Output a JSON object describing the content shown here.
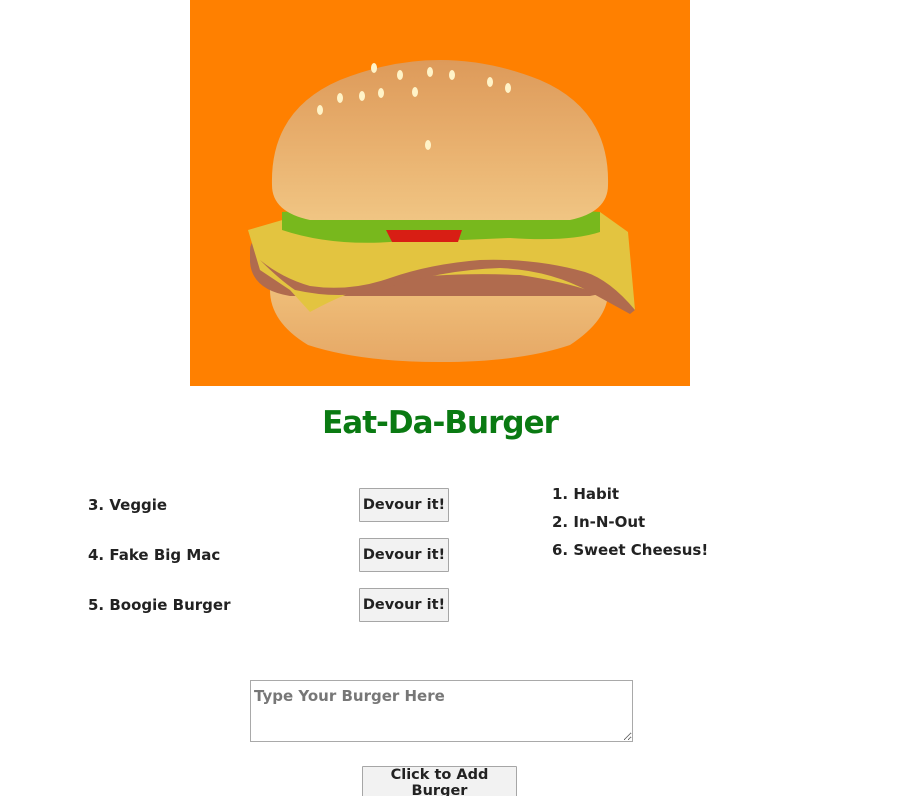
{
  "hero": {
    "image_alt": "burger-illustration",
    "background_color": "#ff8000"
  },
  "header": {
    "title": "Eat-Da-Burger",
    "title_color": "#0a7a12"
  },
  "uneaten_burgers": [
    {
      "label": "3. Veggie",
      "button_label": "Devour it!"
    },
    {
      "label": "4. Fake Big Mac",
      "button_label": "Devour it!"
    },
    {
      "label": "5. Boogie Burger",
      "button_label": "Devour it!"
    }
  ],
  "devoured_burgers": [
    {
      "label": "1. Habit"
    },
    {
      "label": "2. In-N-Out"
    },
    {
      "label": "6. Sweet Cheesus!"
    }
  ],
  "form": {
    "placeholder": "Type Your Burger Here",
    "value": "",
    "submit_label": "Click to Add Burger"
  }
}
